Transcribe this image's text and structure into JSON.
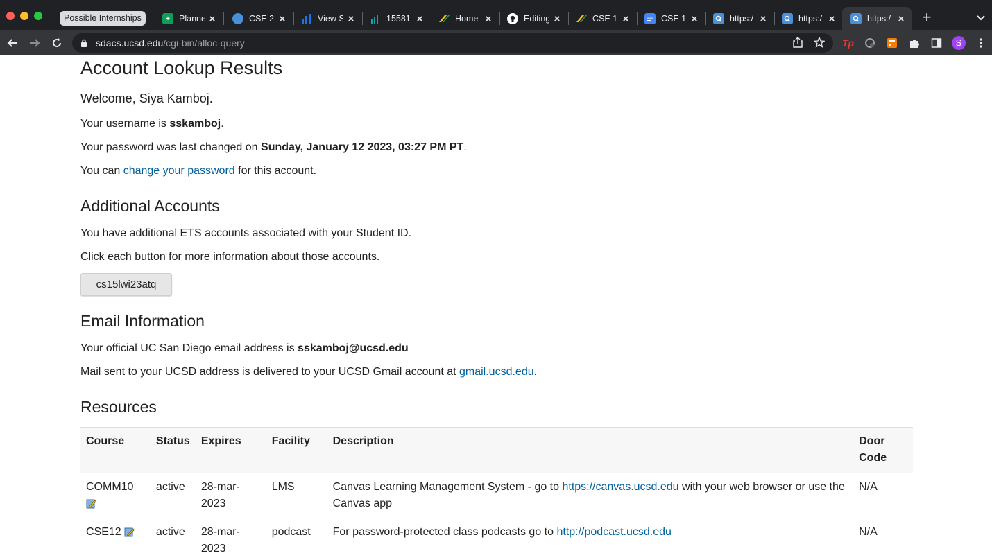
{
  "browser": {
    "tab_group_label": "Possible Internships",
    "tabs": [
      {
        "title": "Planne",
        "icon": "sheets-icon",
        "color": "#0f9d58"
      },
      {
        "title": "CSE 2",
        "icon": "site-icon",
        "color": "#4a90d9"
      },
      {
        "title": "View S",
        "icon": "chart-icon",
        "color": "#1a73e8"
      },
      {
        "title": "15581",
        "icon": "chart-icon",
        "color": "#12a4af"
      },
      {
        "title": "Home",
        "icon": "edstem-icon",
        "color": "#2c9e44"
      },
      {
        "title": "Editing",
        "icon": "github-icon",
        "color": "#ffffff"
      },
      {
        "title": "CSE 1",
        "icon": "edstem-icon",
        "color": "#2c9e44"
      },
      {
        "title": "CSE 1",
        "icon": "docs-icon",
        "color": "#4285f4"
      },
      {
        "title": "https:/",
        "icon": "search-page-icon",
        "color": "#4a90d9"
      },
      {
        "title": "https:/",
        "icon": "search-page-icon",
        "color": "#4a90d9"
      },
      {
        "title": "https:/",
        "icon": "search-page-icon",
        "color": "#4a90d9",
        "active": true
      }
    ],
    "url_host": "sdacs.ucsd.edu",
    "url_path": "/cgi-bin/alloc-query",
    "profile_initial": "S"
  },
  "page": {
    "title": "Account Lookup Results",
    "welcome": "Welcome, Siya Kamboj.",
    "username_prefix": "Your username is ",
    "username": "sskamboj",
    "username_suffix": ".",
    "password_prefix": "Your password was last changed on ",
    "password_date": "Sunday, January 12 2023, 03:27 PM PT",
    "password_suffix": ".",
    "change_prefix": "You can ",
    "change_link": "change your password",
    "change_suffix": " for this account.",
    "additional_heading": "Additional Accounts",
    "additional_text": "You have additional ETS accounts associated with your Student ID.",
    "click_text": "Click each button for more information about those accounts.",
    "account_button": "cs15lwi23atq",
    "email_heading": "Email Information",
    "email_prefix": "Your official UC San Diego email address is ",
    "email": "sskamboj@ucsd.edu",
    "mail_prefix": "Mail sent to your UCSD address is delivered to your UCSD Gmail account at ",
    "mail_link": "gmail.ucsd.edu",
    "mail_suffix": ".",
    "resources_heading": "Resources",
    "table": {
      "headers": {
        "course": "Course",
        "status": "Status",
        "expires": "Expires",
        "facility": "Facility",
        "description": "Description",
        "door_code": "Door Code"
      },
      "rows": [
        {
          "course": "COMM10",
          "status": "active",
          "expires": "28-mar-2023",
          "facility": "LMS",
          "desc_prefix": "Canvas Learning Management System - go to ",
          "desc_link": "https://canvas.ucsd.edu",
          "desc_suffix": " with your web browser or use the Canvas app",
          "door_code": "N/A"
        },
        {
          "course": "CSE12",
          "status": "active",
          "expires": "28-mar-2023",
          "facility": "podcast",
          "desc_prefix": "For password-protected class podcasts go to ",
          "desc_link": "http://podcast.ucsd.edu",
          "desc_suffix": "",
          "door_code": "N/A"
        }
      ]
    }
  }
}
